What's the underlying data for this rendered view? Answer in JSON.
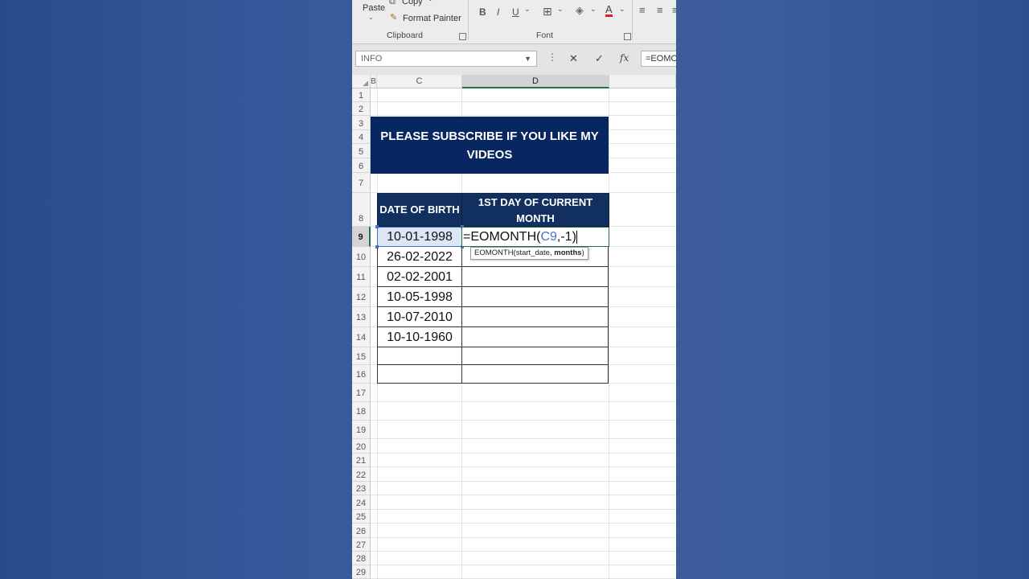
{
  "ribbon": {
    "paste_label": "Paste",
    "copy_label": "Copy",
    "format_painter_label": "Format Painter",
    "clipboard_group": "Clipboard",
    "font_group": "Font",
    "bold": "B",
    "italic": "I",
    "underline": "U",
    "font_color_letter": "A"
  },
  "formula_bar": {
    "name_box": "INFO",
    "cancel_symbol": "✕",
    "enter_symbol": "✓",
    "fx_label": "fx",
    "formula": "=EOMONTH(C9,-1)"
  },
  "columns": {
    "b": "B",
    "c": "C",
    "d": "D"
  },
  "rows": [
    "1",
    "2",
    "3",
    "4",
    "5",
    "6",
    "7",
    "8",
    "9",
    "10",
    "11",
    "12",
    "13",
    "14",
    "15",
    "16",
    "17",
    "18",
    "19",
    "20",
    "21",
    "22",
    "23",
    "24",
    "25",
    "26",
    "27",
    "28",
    "29"
  ],
  "banner": {
    "line1": "PLEASE SUBSCRIBE IF YOU LIKE MY",
    "line2": "VIDEOS"
  },
  "table": {
    "header_c": "DATE OF BIRTH",
    "header_d_line1": "1ST DAY OF CURRENT",
    "header_d_line2": "MONTH",
    "dates": [
      "10-01-1998",
      "26-02-2022",
      "02-02-2001",
      "10-05-1998",
      "10-07-2010",
      "10-10-1960"
    ]
  },
  "editing_cell": {
    "prefix": "=EOMONTH(",
    "ref": "C9",
    "suffix": ",-1)"
  },
  "tooltip": {
    "func": "EOMONTH(start_date, ",
    "arg": "months",
    "close": ")"
  },
  "colors": {
    "banner": "#08265f",
    "header": "#12305f",
    "ref": "#4472c4",
    "selection": "#217346"
  }
}
